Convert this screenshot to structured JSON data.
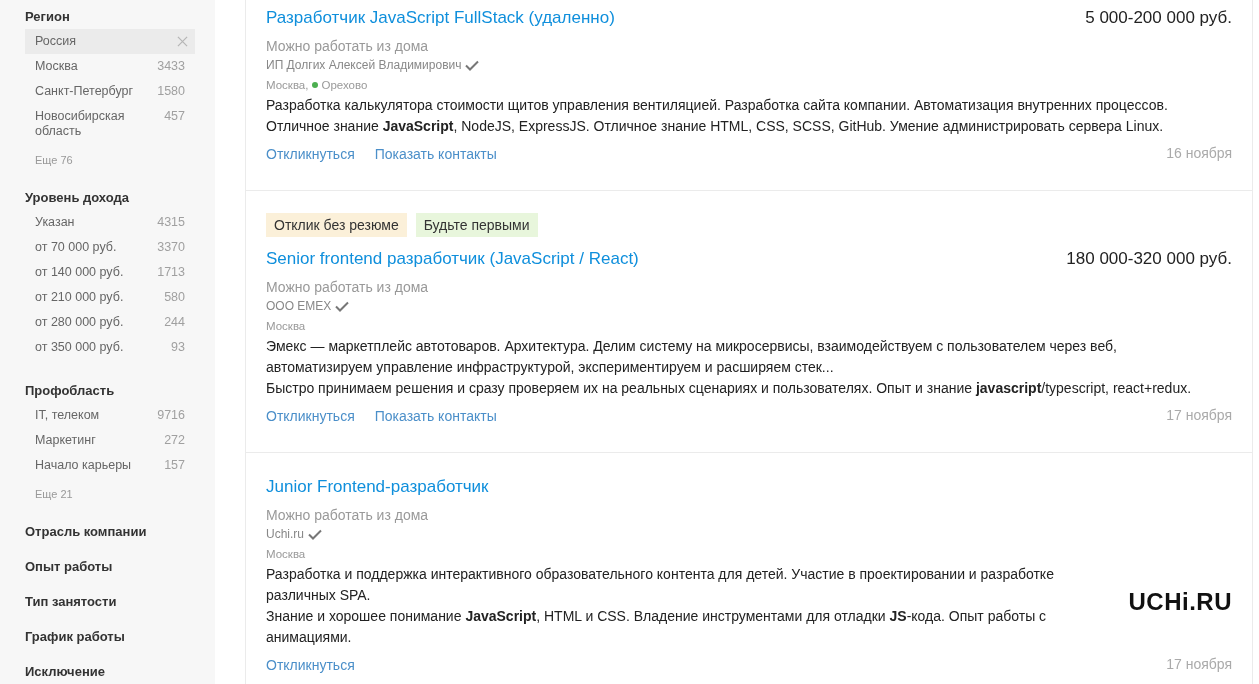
{
  "sidebar": {
    "sections": [
      {
        "title": "Регион",
        "items": [
          {
            "label": "Россия",
            "selected": true
          },
          {
            "label": "Москва",
            "count": "3433",
            "selected": false
          },
          {
            "label": "Санкт-Петербург",
            "count": "1580",
            "selected": false
          },
          {
            "label": "Новосибирская область",
            "count": "457",
            "selected": false
          }
        ],
        "more": "Еще 76"
      },
      {
        "title": "Уровень дохода",
        "items": [
          {
            "label": "Указан",
            "count": "4315",
            "selected": false
          },
          {
            "label": "от 70 000 руб.",
            "count": "3370",
            "selected": false
          },
          {
            "label": "от 140 000 руб.",
            "count": "1713",
            "selected": false
          },
          {
            "label": "от 210 000 руб.",
            "count": "580",
            "selected": false
          },
          {
            "label": "от 280 000 руб.",
            "count": "244",
            "selected": false
          },
          {
            "label": "от 350 000 руб.",
            "count": "93",
            "selected": false
          }
        ]
      },
      {
        "title": "Профобласть",
        "items": [
          {
            "label": "IT, телеком",
            "count": "9716",
            "selected": false
          },
          {
            "label": "Маркетинг",
            "count": "272",
            "selected": false
          },
          {
            "label": "Начало карьеры",
            "count": "157",
            "selected": false
          }
        ],
        "more": "Еще 21"
      },
      {
        "title": "Отрасль компании"
      },
      {
        "title": "Опыт работы"
      },
      {
        "title": "Тип занятости"
      },
      {
        "title": "График работы"
      },
      {
        "title": "Исключение"
      }
    ]
  },
  "vacancies": [
    {
      "title": "Разработчик JavaScript FullStack (удаленно)",
      "salary": "5 000-200 000 руб.",
      "remote": "Можно работать из дома",
      "company": "ИП Долгих Алексей Владимирович",
      "verified": true,
      "city": "Москва,",
      "metro": {
        "name": "Орехово",
        "color": "#4caf50"
      },
      "description": [
        "Разработка калькулятора стоимости щитов управления вентиляцией. Разработка сайта компании. Автоматизация внутренних процессов.",
        "Отличное знание **JavaScript**, NodeJS, ExpressJS. Отличное знание HTML, CSS, SCSS, GitHub. Умение администрировать сервера Linux."
      ],
      "actions": [
        "Откликнуться",
        "Показать контакты"
      ],
      "date": "16 ноября"
    },
    {
      "badges": [
        {
          "label": "Отклик без резюме",
          "color": "#fbf0d9"
        },
        {
          "label": "Будьте первыми",
          "color": "#e8f6dc"
        }
      ],
      "title": "Senior frontend разработчик (JavaScript / React)",
      "salary": "180 000-320 000 руб.",
      "remote": "Можно работать из дома",
      "company": "ООО EMEX",
      "verified": true,
      "city": "Москва",
      "description": [
        "Эмекс — маркетплейс автотоваров. Архитектура. Делим систему на микросервисы, взаимодействуем с пользователем через веб, автоматизируем управление инфраструктурой, экспериментируем и расширяем стек...",
        "Быстро принимаем решения и сразу проверяем их на реальных сценариях и пользователях. Опыт и знание **javascript**/typescript, react+redux."
      ],
      "actions": [
        "Откликнуться",
        "Показать контакты"
      ],
      "date": "17 ноября"
    },
    {
      "title": "Junior Frontend-разработчик",
      "remote": "Можно работать из дома",
      "company": "Uchi.ru",
      "verified": true,
      "city": "Москва",
      "logo": "UCHi.RU",
      "description": [
        "Разработка и поддержка интерактивного образовательного контента для детей. Участие в проектировании и разработке различных SPA.",
        "Знание и хорошее понимание **JavaScript**, HTML и CSS. Владение инструментами для отладки **JS**-кода. Опыт работы с анимациями."
      ],
      "actions": [
        "Откликнуться"
      ],
      "date": "17 ноября"
    }
  ]
}
